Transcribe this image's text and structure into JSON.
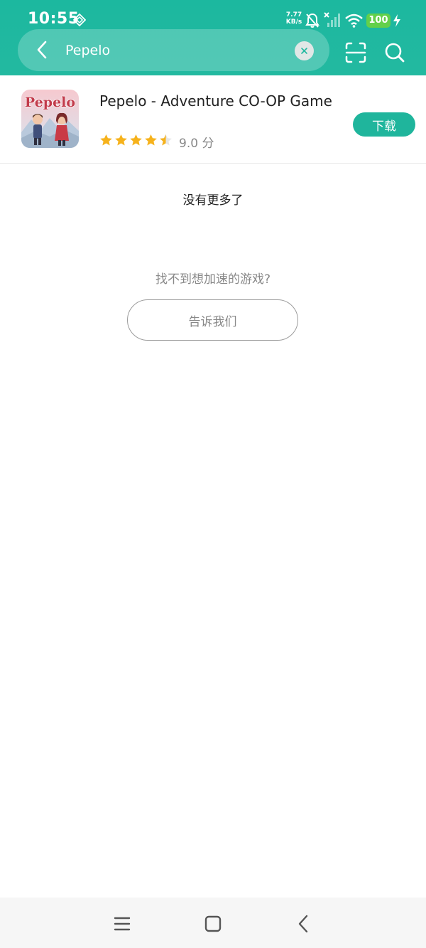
{
  "status_bar": {
    "time": "10:55",
    "net_speed_value": "7.77",
    "net_speed_unit": "KB/s",
    "battery": "100"
  },
  "search": {
    "value": "Pepelo"
  },
  "result": {
    "title": "Pepelo - Adventure CO-OP Game",
    "icon_text": "Pepelo",
    "rating_text": "9.0 分",
    "rating_value": 4.5,
    "download_label": "下载"
  },
  "footer": {
    "no_more": "没有更多了",
    "not_found": "找不到想加速的游戏?",
    "tell_us": "告诉我们"
  },
  "colors": {
    "accent": "#1fb59c",
    "star": "#f6b21b",
    "battery": "#63d04a"
  }
}
